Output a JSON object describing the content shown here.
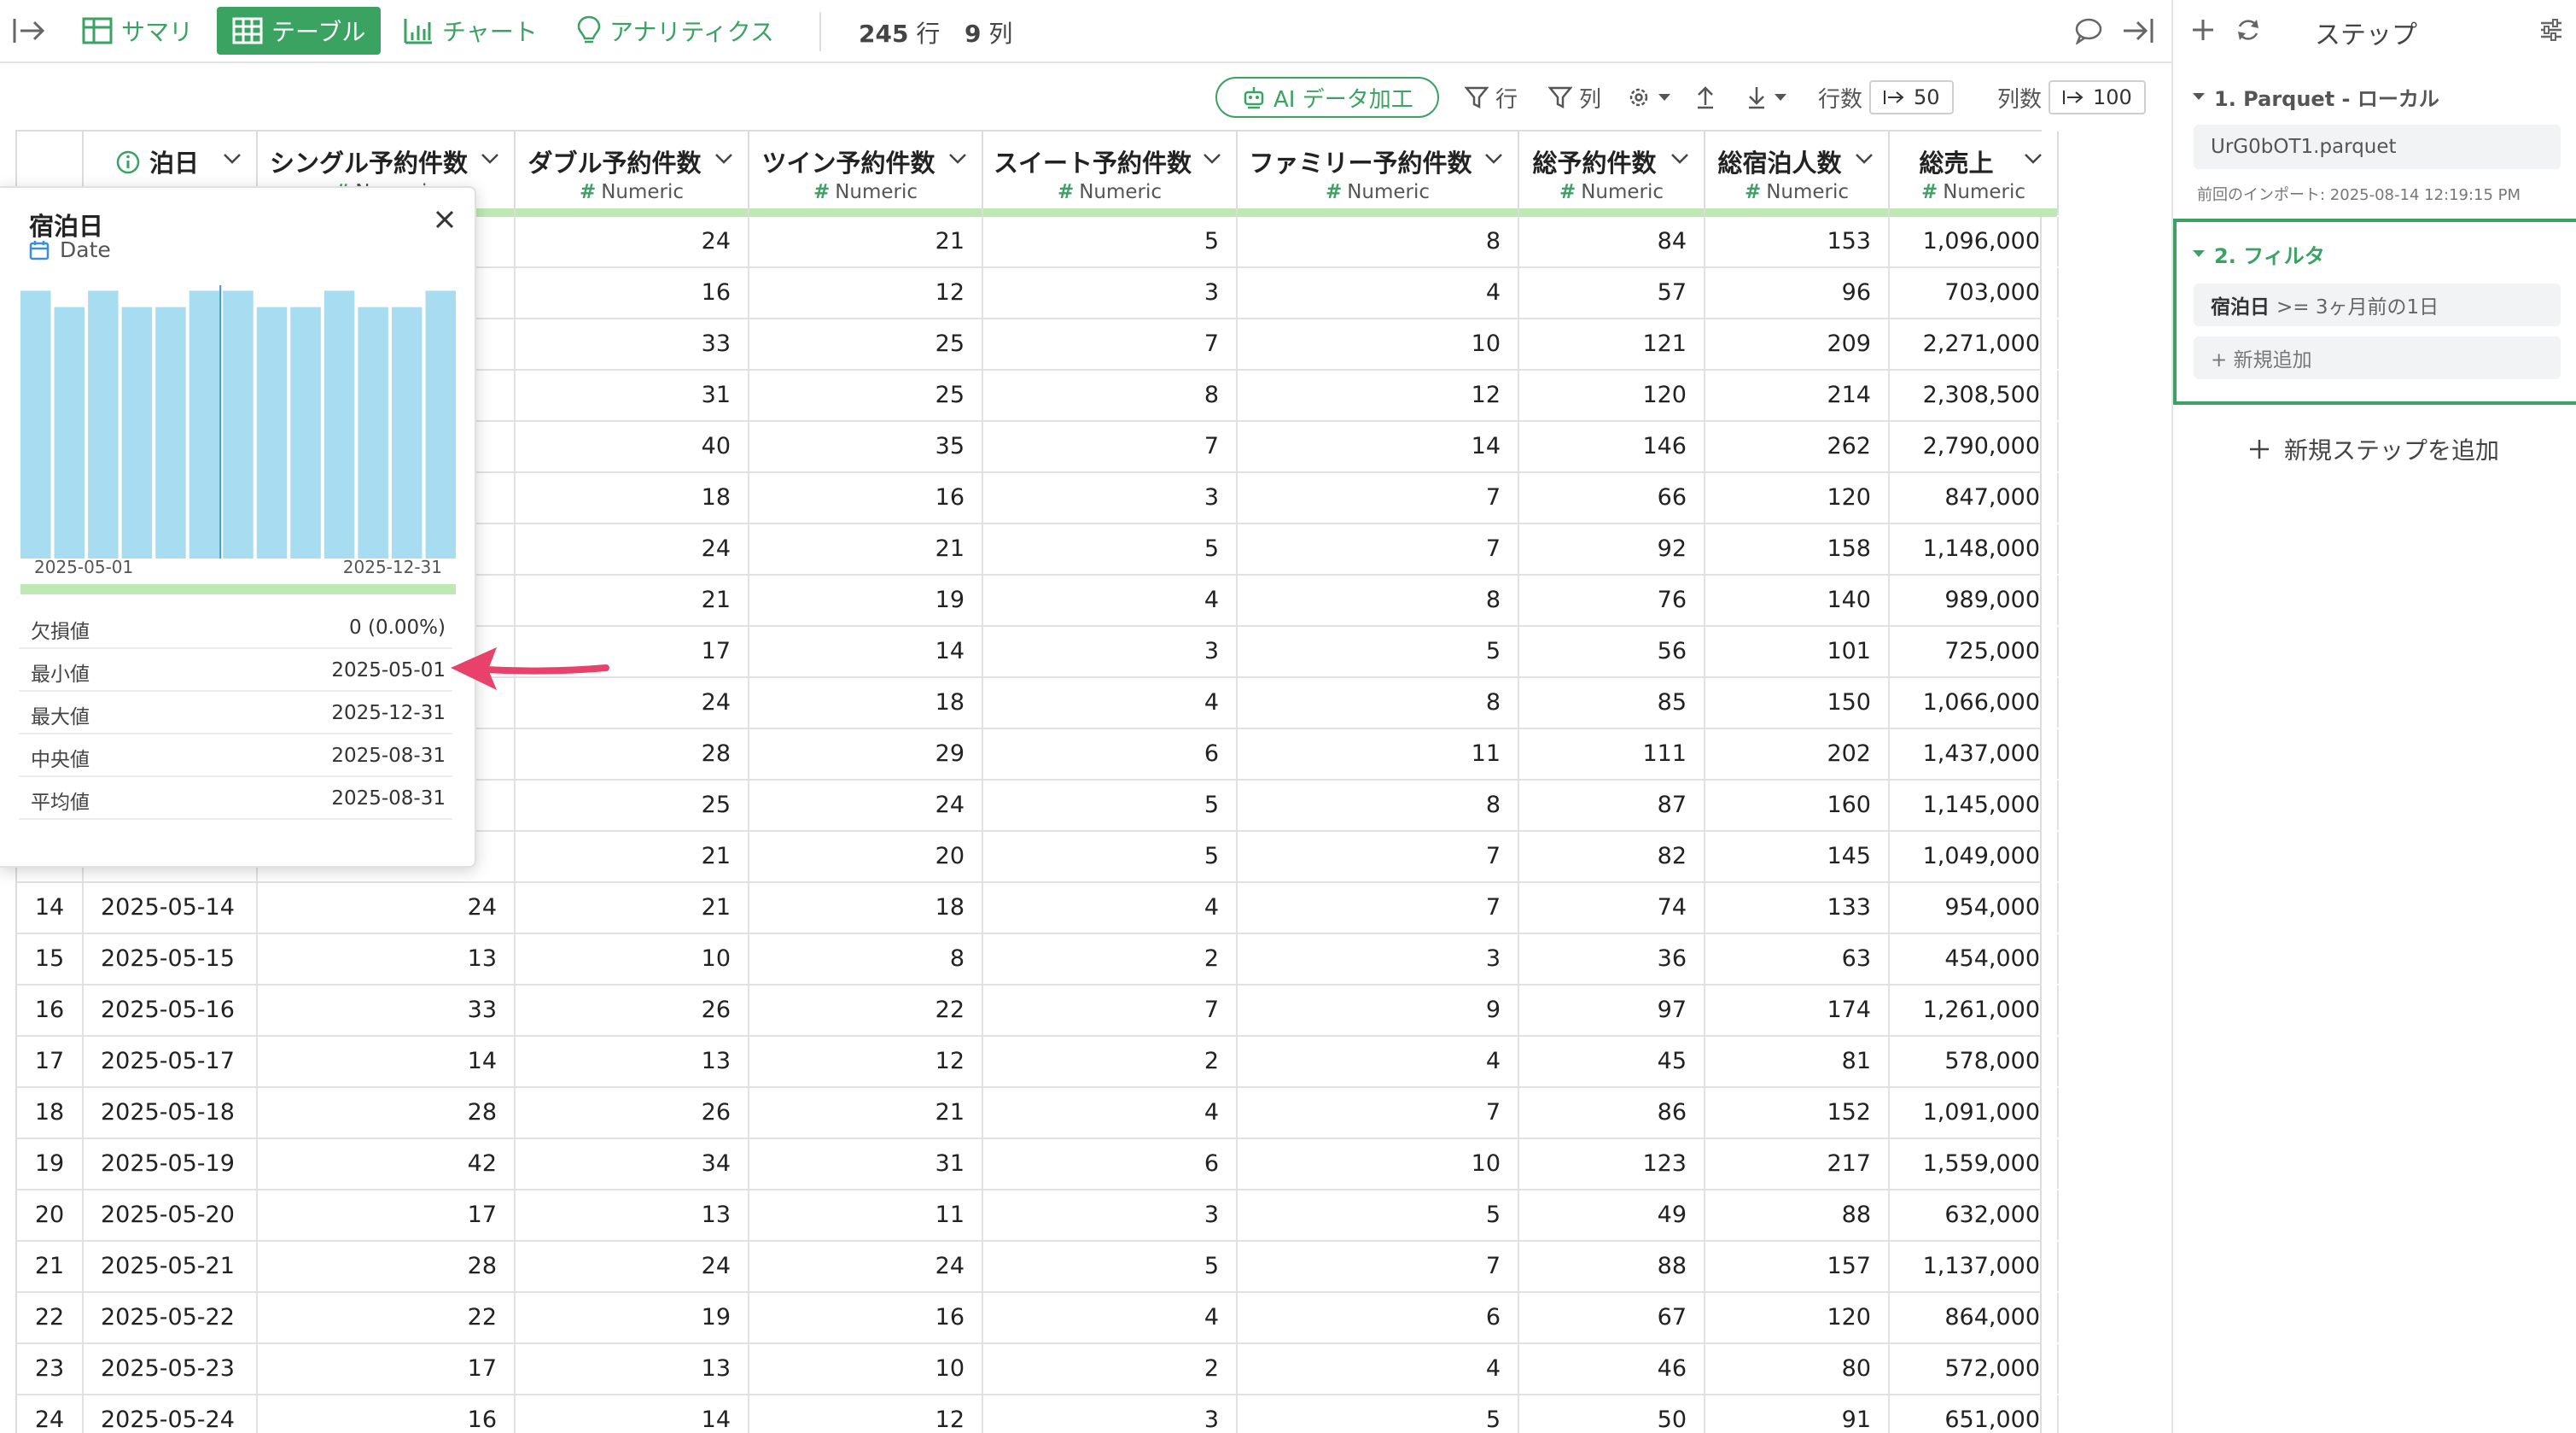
{
  "toolbar": {
    "tabs": [
      {
        "label": "サマリ",
        "icon": "table-grid-icon"
      },
      {
        "label": "テーブル",
        "icon": "table-grid-icon",
        "active": true
      },
      {
        "label": "チャート",
        "icon": "bar-chart-icon"
      },
      {
        "label": "アナリティクス",
        "icon": "lightbulb-icon"
      }
    ],
    "row_count": "245",
    "row_unit": "行",
    "col_count": "9",
    "col_unit": "列"
  },
  "toolbar2": {
    "ai_label": "AI データ加工",
    "filter_row_label": "行",
    "filter_col_label": "列",
    "rows_label": "行数",
    "rows_value": "50",
    "cols_label": "列数",
    "cols_value": "100"
  },
  "columns": [
    {
      "name": "泊日",
      "type": ""
    },
    {
      "name": "シングル予約件数",
      "type": "Numeric"
    },
    {
      "name": "ダブル予約件数",
      "type": "Numeric"
    },
    {
      "name": "ツイン予約件数",
      "type": "Numeric"
    },
    {
      "name": "スイート予約件数",
      "type": "Numeric"
    },
    {
      "name": "ファミリー予約件数",
      "type": "Numeric"
    },
    {
      "name": "総予約件数",
      "type": "Numeric"
    },
    {
      "name": "総宿泊人数",
      "type": "Numeric"
    },
    {
      "name": "総売上",
      "type": "Numeric"
    }
  ],
  "rows": [
    [
      "",
      "",
      "",
      "24",
      "21",
      "5",
      "8",
      "84",
      "153",
      "1,096,000"
    ],
    [
      "",
      "",
      "",
      "16",
      "12",
      "3",
      "4",
      "57",
      "96",
      "703,000"
    ],
    [
      "",
      "",
      "",
      "33",
      "25",
      "7",
      "10",
      "121",
      "209",
      "2,271,000"
    ],
    [
      "",
      "",
      "",
      "31",
      "25",
      "8",
      "12",
      "120",
      "214",
      "2,308,500"
    ],
    [
      "",
      "",
      "",
      "40",
      "35",
      "7",
      "14",
      "146",
      "262",
      "2,790,000"
    ],
    [
      "",
      "",
      "",
      "18",
      "16",
      "3",
      "7",
      "66",
      "120",
      "847,000"
    ],
    [
      "",
      "",
      "",
      "24",
      "21",
      "5",
      "7",
      "92",
      "158",
      "1,148,000"
    ],
    [
      "",
      "",
      "",
      "21",
      "19",
      "4",
      "8",
      "76",
      "140",
      "989,000"
    ],
    [
      "",
      "",
      "",
      "17",
      "14",
      "3",
      "5",
      "56",
      "101",
      "725,000"
    ],
    [
      "",
      "",
      "",
      "24",
      "18",
      "4",
      "8",
      "85",
      "150",
      "1,066,000"
    ],
    [
      "",
      "",
      "",
      "28",
      "29",
      "6",
      "11",
      "111",
      "202",
      "1,437,000"
    ],
    [
      "",
      "",
      "",
      "25",
      "24",
      "5",
      "8",
      "87",
      "160",
      "1,145,000"
    ],
    [
      "",
      "",
      "",
      "21",
      "20",
      "5",
      "7",
      "82",
      "145",
      "1,049,000"
    ],
    [
      "14",
      "2025-05-14",
      "24",
      "21",
      "18",
      "4",
      "7",
      "74",
      "133",
      "954,000"
    ],
    [
      "15",
      "2025-05-15",
      "13",
      "10",
      "8",
      "2",
      "3",
      "36",
      "63",
      "454,000"
    ],
    [
      "16",
      "2025-05-16",
      "33",
      "26",
      "22",
      "7",
      "9",
      "97",
      "174",
      "1,261,000"
    ],
    [
      "17",
      "2025-05-17",
      "14",
      "13",
      "12",
      "2",
      "4",
      "45",
      "81",
      "578,000"
    ],
    [
      "18",
      "2025-05-18",
      "28",
      "26",
      "21",
      "4",
      "7",
      "86",
      "152",
      "1,091,000"
    ],
    [
      "19",
      "2025-05-19",
      "42",
      "34",
      "31",
      "6",
      "10",
      "123",
      "217",
      "1,559,000"
    ],
    [
      "20",
      "2025-05-20",
      "17",
      "13",
      "11",
      "3",
      "5",
      "49",
      "88",
      "632,000"
    ],
    [
      "21",
      "2025-05-21",
      "28",
      "24",
      "24",
      "5",
      "7",
      "88",
      "157",
      "1,137,000"
    ],
    [
      "22",
      "2025-05-22",
      "22",
      "19",
      "16",
      "4",
      "6",
      "67",
      "120",
      "864,000"
    ],
    [
      "23",
      "2025-05-23",
      "17",
      "13",
      "10",
      "2",
      "4",
      "46",
      "80",
      "572,000"
    ],
    [
      "24",
      "2025-05-24",
      "16",
      "14",
      "12",
      "3",
      "5",
      "50",
      "91",
      "651,000"
    ]
  ],
  "popup": {
    "title": "宿泊日",
    "type": "Date",
    "hist_start": "2025-05-01",
    "hist_end": "2025-12-31",
    "hist_levels": [
      0.98,
      0.92,
      0.98,
      0.92,
      0.92,
      0.98,
      0.98,
      0.92,
      0.92,
      0.98,
      0.92,
      0.92,
      0.98
    ],
    "stats": [
      {
        "label": "欠損値",
        "value": "0 (0.00%)"
      },
      {
        "label": "最小値",
        "value": "2025-05-01"
      },
      {
        "label": "最大値",
        "value": "2025-12-31"
      },
      {
        "label": "中央値",
        "value": "2025-08-31"
      },
      {
        "label": "平均値",
        "value": "2025-08-31"
      }
    ]
  },
  "steps": {
    "title": "ステップ",
    "step1": {
      "title": "1. Parquet - ローカル",
      "file": "UrG0bOT1.parquet",
      "note": "前回のインポート: 2025-08-14 12:19:15 PM"
    },
    "step2": {
      "title": "2. フィルタ",
      "filter_col": "宿泊日",
      "filter_expr": ">= 3ヶ月前の1日",
      "add_label": "+ 新規追加"
    },
    "add_step": "新規ステップを追加"
  },
  "colors": {
    "accent": "#3aa362",
    "hist_bar": "#a8dcf0",
    "arrow": "#e8426a"
  }
}
